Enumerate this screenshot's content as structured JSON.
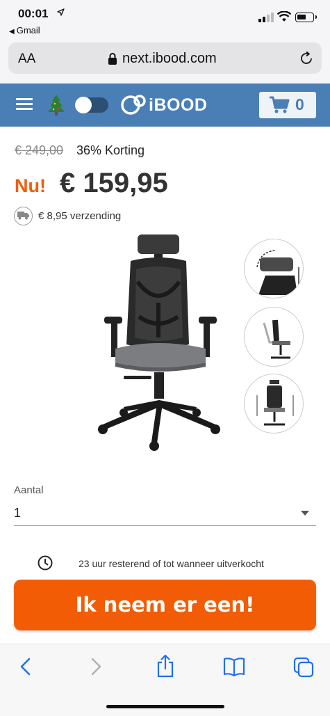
{
  "status_bar": {
    "time": "00:01",
    "back_app": "Gmail"
  },
  "address_bar": {
    "text_size_label": "AA",
    "url": "next.ibood.com"
  },
  "header": {
    "logo": "iBOOD",
    "cart_count": "0"
  },
  "price": {
    "old": "€ 249,00",
    "discount": "36% Korting",
    "now_label": "Nu!",
    "current": "€ 159,95",
    "shipping": "€ 8,95 verzending"
  },
  "quantity": {
    "label": "Aantal",
    "value": "1"
  },
  "remaining_text": "23 uur resterend of tot wanneer uitverkocht",
  "buy_button": "Ik neem er een!",
  "colors": {
    "brand_blue": "#4a7fb5",
    "accent_orange": "#f25c05",
    "ios_blue": "#1e6ff0"
  },
  "icons": [
    "location-arrow-icon",
    "signal-icon",
    "wifi-icon",
    "battery-icon",
    "lock-icon",
    "reload-icon",
    "hamburger-menu-icon",
    "christmas-tree-icon",
    "cart-icon",
    "truck-icon",
    "clock-icon",
    "back-icon",
    "forward-icon",
    "share-icon",
    "bookmarks-icon",
    "tabs-icon"
  ]
}
